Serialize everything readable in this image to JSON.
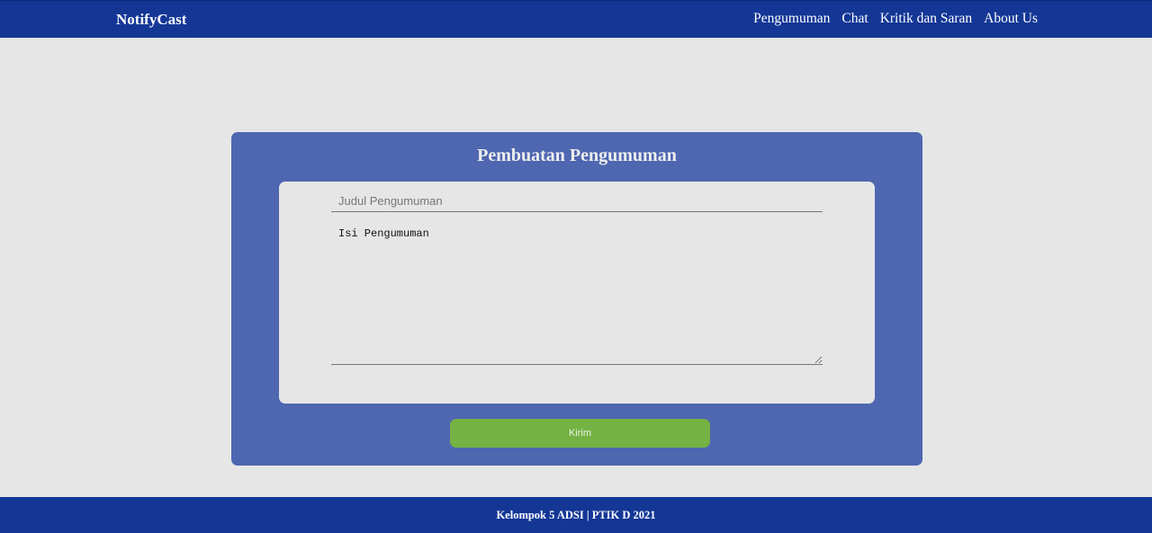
{
  "navbar": {
    "brand": "NotifyCast",
    "links": [
      {
        "label": "Pengumuman"
      },
      {
        "label": "Chat"
      },
      {
        "label": "Kritik dan Saran"
      },
      {
        "label": "About Us"
      }
    ]
  },
  "form": {
    "title": "Pembuatan Pengumuman",
    "title_field": {
      "placeholder": "Judul Pengumuman",
      "value": ""
    },
    "body_field": {
      "placeholder": "Isi Pengumuman",
      "value": ""
    },
    "submit_label": "Kirim"
  },
  "footer": {
    "text": "Kelompok 5 ADSI | PTIK D 2021"
  },
  "colors": {
    "nav_bg": "#143796",
    "card_bg": "#4e67b0",
    "page_bg": "#e6e6e6",
    "button_bg": "#74b244"
  }
}
